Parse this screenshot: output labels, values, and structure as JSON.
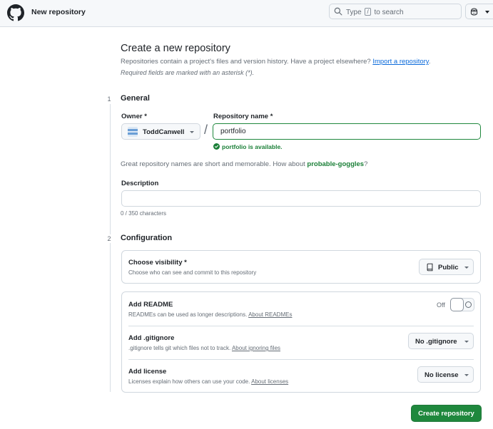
{
  "header": {
    "title": "New repository",
    "search_prefix": "Type",
    "search_key": "/",
    "search_suffix": "to search"
  },
  "intro": {
    "title": "Create a new repository",
    "description": "Repositories contain a project's files and version history. Have a project elsewhere?",
    "import_link": "Import a repository",
    "period": ".",
    "required_note": "Required fields are marked with an asterisk (*)."
  },
  "general": {
    "step": "1",
    "title": "General",
    "owner_label": "Owner *",
    "owner_name": "ToddCanwell",
    "separator": "/",
    "repo_label": "Repository name *",
    "repo_value": "portfolio",
    "availability": "portfolio is available.",
    "suggest_text": "Great repository names are short and memorable. How about",
    "suggest_name": "probable-goggles",
    "suggest_end": "?",
    "description_label": "Description",
    "description_value": "",
    "char_count": "0 / 350 characters"
  },
  "configuration": {
    "step": "2",
    "title": "Configuration",
    "visibility": {
      "title": "Choose visibility *",
      "subtitle": "Choose who can see and commit to this repository",
      "value": "Public"
    },
    "readme": {
      "title": "Add README",
      "subtitle": "READMEs can be used as longer descriptions.",
      "link": "About READMEs",
      "toggle_label": "Off",
      "enabled": false
    },
    "gitignore": {
      "title": "Add .gitignore",
      "subtitle": ".gitignore tells git which files not to track.",
      "link": "About ignoring files",
      "value": "No .gitignore"
    },
    "license": {
      "title": "Add license",
      "subtitle": "Licenses explain how others can use your code.",
      "link": "About licenses",
      "value": "No license"
    }
  },
  "actions": {
    "create_label": "Create repository"
  },
  "colors": {
    "primary_green": "#1f883d",
    "success_text": "#1a7f37",
    "link_blue": "#0969da",
    "muted_text": "#656d76"
  }
}
